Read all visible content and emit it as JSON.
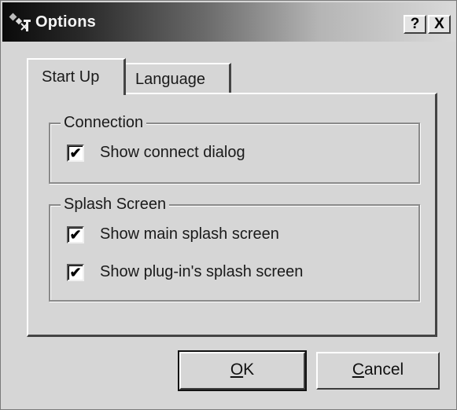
{
  "window": {
    "title": "Options",
    "help_button": "?",
    "close_button": "X"
  },
  "tabs": [
    {
      "label": "Start Up",
      "active": true
    },
    {
      "label": "Language",
      "active": false
    }
  ],
  "connection_group": {
    "legend": "Connection",
    "options": [
      {
        "label": "Show connect dialog",
        "checked": true
      }
    ]
  },
  "splash_group": {
    "legend": "Splash Screen",
    "options": [
      {
        "label": "Show main splash screen",
        "checked": true
      },
      {
        "label": "Show plug-in's splash screen",
        "checked": true
      }
    ]
  },
  "buttons": {
    "ok_accel": "O",
    "ok_rest": "K",
    "cancel_accel": "C",
    "cancel_rest": "ancel"
  },
  "check_glyph": "✔",
  "icons": {
    "app": "options-app-icon",
    "help": "help-icon",
    "close": "close-icon"
  }
}
